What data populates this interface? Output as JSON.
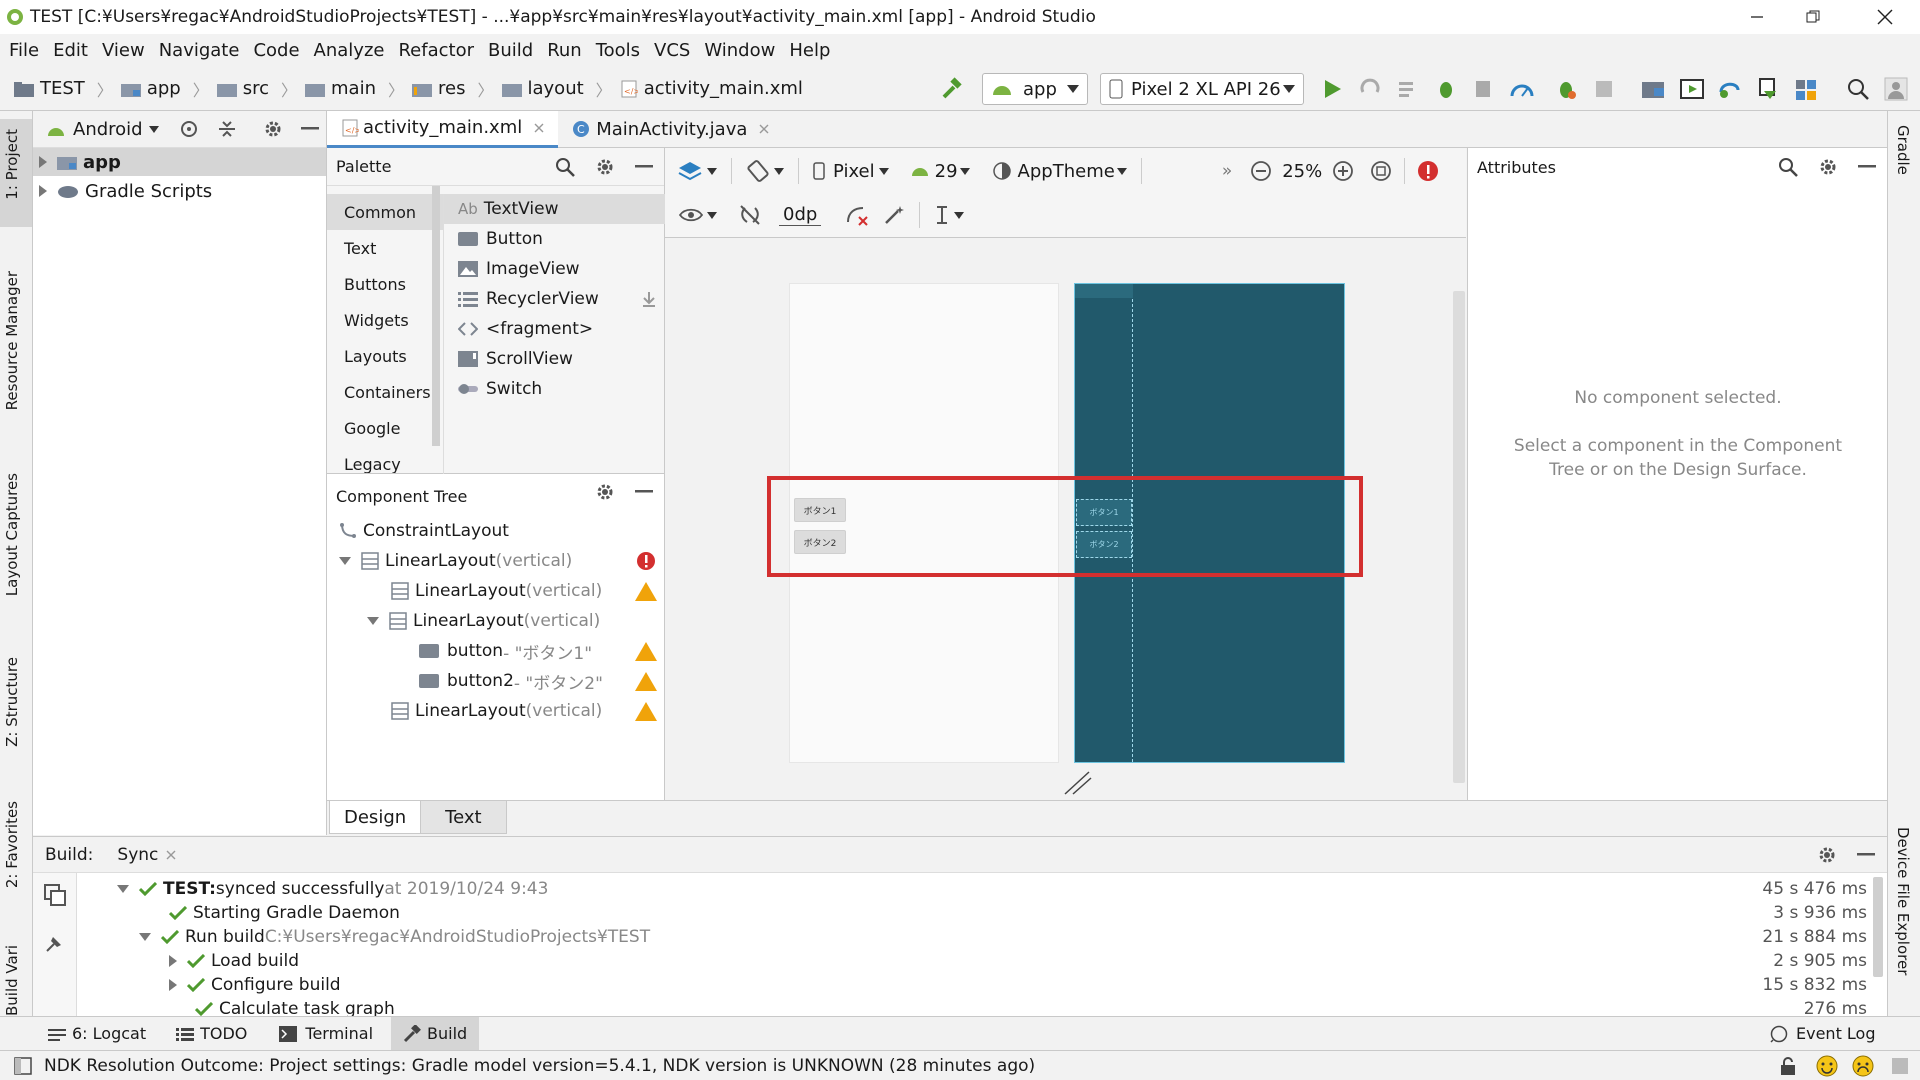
{
  "window": {
    "title": "TEST [C:¥Users¥regac¥AndroidStudioProjects¥TEST] - ...¥app¥src¥main¥res¥layout¥activity_main.xml [app] - Android Studio"
  },
  "menu": [
    "File",
    "Edit",
    "View",
    "Navigate",
    "Code",
    "Analyze",
    "Refactor",
    "Build",
    "Run",
    "Tools",
    "VCS",
    "Window",
    "Help"
  ],
  "breadcrumbs": [
    "TEST",
    "app",
    "src",
    "main",
    "res",
    "layout",
    "activity_main.xml"
  ],
  "toolbar": {
    "config": "app",
    "device": "Pixel 2 XL API 26"
  },
  "left_tabs": [
    "1: Project",
    "Resource Manager",
    "Layout Captures",
    "Z: Structure",
    "2: Favorites",
    "Build Variants"
  ],
  "right_tabs": [
    "Gradle",
    "Device File Explorer"
  ],
  "project": {
    "view": "Android",
    "items": [
      "app",
      "Gradle Scripts"
    ]
  },
  "editor_tabs": [
    "activity_main.xml",
    "MainActivity.java"
  ],
  "palette": {
    "title": "Palette",
    "categories": [
      "Common",
      "Text",
      "Buttons",
      "Widgets",
      "Layouts",
      "Containers",
      "Google",
      "Legacy"
    ],
    "items": [
      "TextView",
      "Button",
      "ImageView",
      "RecyclerView",
      "<fragment>",
      "ScrollView",
      "Switch"
    ],
    "textview_prefix": "Ab"
  },
  "component_tree": {
    "title": "Component Tree",
    "nodes": [
      {
        "label": "ConstraintLayout",
        "hint": ""
      },
      {
        "label": "LinearLayout",
        "hint": "(vertical)"
      },
      {
        "label": "LinearLayout",
        "hint": "(vertical)"
      },
      {
        "label": "LinearLayout",
        "hint": "(vertical)"
      },
      {
        "label": "button",
        "hint": "- \"ボタン1\""
      },
      {
        "label": "button2",
        "hint": "- \"ボタン2\""
      },
      {
        "label": "LinearLayout",
        "hint": "(vertical)"
      }
    ]
  },
  "design_toolbar": {
    "device": "Pixel",
    "api": "29",
    "theme": "AppTheme",
    "zoom": "25%",
    "margin": "0dp",
    "overflow": "»"
  },
  "preview": {
    "button1": "ボタン1",
    "button2": "ボタン2"
  },
  "attributes": {
    "title": "Attributes",
    "empty_title": "No component selected.",
    "empty_hint_1": "Select a component in the Component",
    "empty_hint_2": "Tree or on the Design Surface."
  },
  "design_tabs": [
    "Design",
    "Text"
  ],
  "build": {
    "label": "Build:",
    "tab": "Sync",
    "rows": [
      {
        "bold": "TEST:",
        "text": " synced successfully",
        "extra": " at 2019/10/24 9:43",
        "time": "45 s 476 ms"
      },
      {
        "bold": "",
        "text": "Starting Gradle Daemon",
        "extra": "",
        "time": "3 s 936 ms"
      },
      {
        "bold": "",
        "text": "Run build",
        "extra": " C:¥Users¥regac¥AndroidStudioProjects¥TEST",
        "time": "21 s 884 ms"
      },
      {
        "bold": "",
        "text": "Load build",
        "extra": "",
        "time": "2 s 905 ms"
      },
      {
        "bold": "",
        "text": "Configure build",
        "extra": "",
        "time": "15 s 832 ms"
      },
      {
        "bold": "",
        "text": "Calculate task graph",
        "extra": "",
        "time": "276 ms"
      }
    ]
  },
  "bottom_tabs": [
    "6: Logcat",
    "TODO",
    "Terminal",
    "Build"
  ],
  "event_log": "Event Log",
  "status": "NDK Resolution Outcome: Project settings: Gradle model version=5.4.1, NDK version is UNKNOWN (28 minutes ago)",
  "colors": {
    "blueprint": "#21596b",
    "highlight": "#d32f2f",
    "accent": "#4a88c7",
    "android_green": "#7cb342",
    "warning": "#f0a30a",
    "error": "#d32f2f"
  }
}
